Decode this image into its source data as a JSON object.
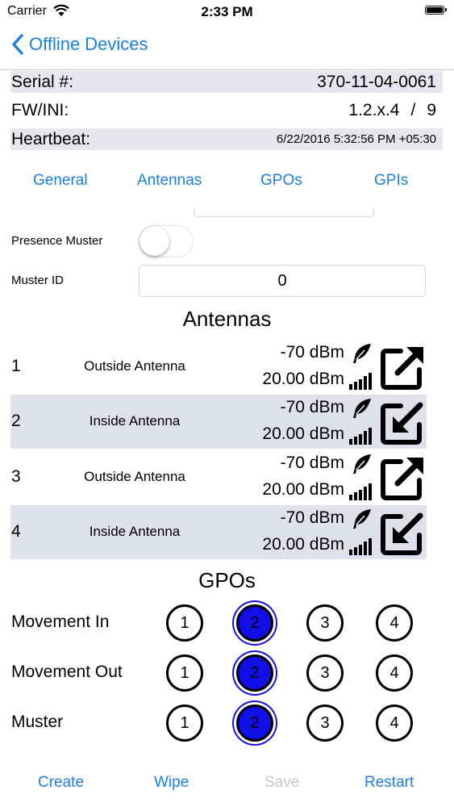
{
  "status_bar": {
    "carrier": "Carrier",
    "time": "2:33 PM"
  },
  "nav": {
    "back_label": "Offline Devices"
  },
  "info": {
    "serial_label": "Serial #:",
    "serial_value": "370-11-04-0061",
    "fw_label": "FW/INI:",
    "fw_value": "1.2.x.4",
    "fw_separator": "/",
    "ini_value": "9",
    "heartbeat_label": "Heartbeat:",
    "heartbeat_value": "6/22/2016 5:32:56 PM +05:30"
  },
  "tabs": [
    "General",
    "Antennas",
    "GPOs",
    "GPIs"
  ],
  "presence_muster": {
    "label": "Presence Muster",
    "enabled": false
  },
  "muster_id": {
    "label": "Muster ID",
    "value": "0"
  },
  "antennas": {
    "title": "Antennas",
    "rows": [
      {
        "number": "1",
        "name": "Outside Antenna",
        "rssi": "-70 dBm",
        "power": "20.00 dBm",
        "direction": "outgoing-arrow-icon"
      },
      {
        "number": "2",
        "name": "Inside Antenna",
        "rssi": "-70 dBm",
        "power": "20.00 dBm",
        "direction": "incoming-arrow-icon"
      },
      {
        "number": "3",
        "name": "Outside Antenna",
        "rssi": "-70 dBm",
        "power": "20.00 dBm",
        "direction": "outgoing-arrow-icon"
      },
      {
        "number": "4",
        "name": "Inside Antenna",
        "rssi": "-70 dBm",
        "power": "20.00 dBm",
        "direction": "incoming-arrow-icon"
      }
    ]
  },
  "gpos": {
    "title": "GPOs",
    "options": [
      "1",
      "2",
      "3",
      "4"
    ],
    "rows": [
      {
        "label": "Movement In",
        "selected": "2"
      },
      {
        "label": "Movement Out",
        "selected": "2"
      },
      {
        "label": "Muster",
        "selected": "2"
      }
    ]
  },
  "actions": {
    "create": "Create",
    "wipe": "Wipe",
    "save": "Save",
    "restart": "Restart"
  },
  "colors": {
    "accent": "#1a7fe0",
    "selected_gpo": "#1010e6",
    "row_shade": "#dde1ea",
    "disabled": "#c7c7cc"
  }
}
